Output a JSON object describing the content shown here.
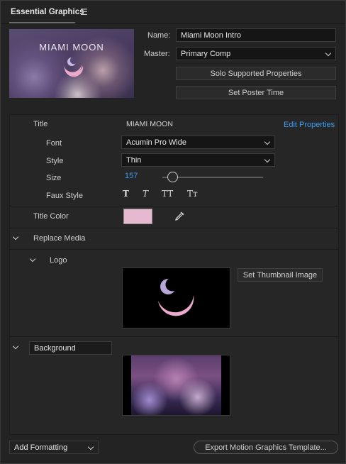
{
  "panel": {
    "title": "Essential Graphics",
    "menu_icon": "hamburger-menu-icon"
  },
  "poster": {
    "text": "MIAMI MOON"
  },
  "name": {
    "label": "Name:",
    "value": "Miami Moon Intro"
  },
  "master": {
    "label": "Master:",
    "value": "Primary Comp"
  },
  "buttons": {
    "solo": "Solo Supported Properties",
    "poster_time": "Set Poster Time"
  },
  "title_section": {
    "label": "Title",
    "value": "MIAMI MOON",
    "edit": "Edit Properties",
    "font": {
      "label": "Font",
      "value": "Acumin Pro Wide"
    },
    "style": {
      "label": "Style",
      "value": "Thin"
    },
    "size": {
      "label": "Size",
      "value": "157",
      "slider_level": 0.08
    },
    "faux": {
      "label": "Faux Style",
      "glyphs": [
        "T",
        "T",
        "TT",
        "Tт"
      ]
    }
  },
  "title_color": {
    "label": "Title Color",
    "color": "#e7b9d0",
    "icon": "eyedropper-icon"
  },
  "replace_media": {
    "label": "Replace Media"
  },
  "logo": {
    "label": "Logo",
    "button": "Set Thumbnail Image"
  },
  "background": {
    "value": "Background"
  },
  "footer": {
    "add_formatting": "Add Formatting",
    "export": "Export Motion Graphics Template..."
  },
  "colors": {
    "accent": "#3a9ef5",
    "pink": "#e7b9d0",
    "lavender": "#b8a6d8"
  }
}
